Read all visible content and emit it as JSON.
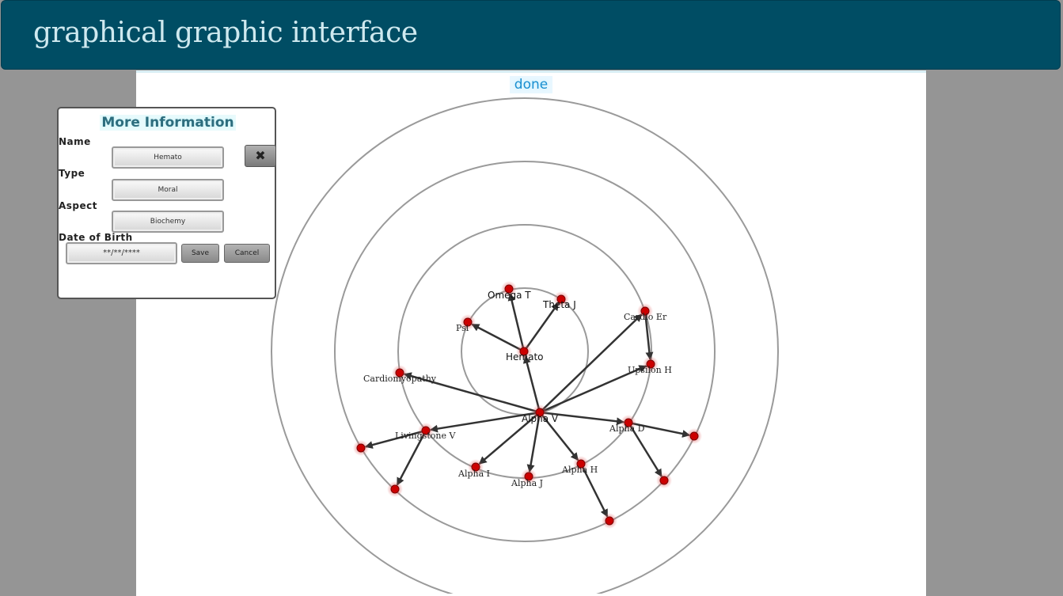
{
  "header": {
    "title": "graphical graphic interface"
  },
  "canvas": {
    "done_label": "done"
  },
  "info_panel": {
    "title": "More Information",
    "name_label": "Name",
    "name_value": "Hemato",
    "type_label": "Type",
    "type_value": "Moral",
    "aspect_label": "Aspect",
    "aspect_value": "Biochemy",
    "dob_label": "Date of Birth",
    "dob_value": "**/**/****",
    "save_label": "Save",
    "cancel_label": "Cancel",
    "close_icon": "close-x-icon"
  },
  "graph": {
    "colors": {
      "ring": "#9a9a9a",
      "edge": "#333333",
      "node": "#cc0000",
      "node_glow": "#e08a8a"
    },
    "nodes": [
      {
        "id": "hemato",
        "label": "Hemato"
      },
      {
        "id": "omegat",
        "label": "Omega T"
      },
      {
        "id": "thetaj",
        "label": "Theta J"
      },
      {
        "id": "psi",
        "label": "Psi"
      },
      {
        "id": "cardioer",
        "label": "Cardio Er"
      },
      {
        "id": "upsilonh",
        "label": "Upsilon H"
      },
      {
        "id": "cardiomyopathy",
        "label": "Cardiomyopathy"
      },
      {
        "id": "alphav",
        "label": "Alpha V"
      },
      {
        "id": "livingstonev",
        "label": "Livingstone V"
      },
      {
        "id": "alphad",
        "label": "Alpha D"
      },
      {
        "id": "alphai",
        "label": "Alpha I"
      },
      {
        "id": "alphaj",
        "label": "Alpha J"
      },
      {
        "id": "alphah",
        "label": "Alpha H"
      },
      {
        "id": "n1",
        "label": ""
      },
      {
        "id": "n2",
        "label": ""
      },
      {
        "id": "n3",
        "label": ""
      },
      {
        "id": "n4",
        "label": ""
      },
      {
        "id": "n5",
        "label": ""
      }
    ],
    "edges": [
      [
        "alphav",
        "hemato"
      ],
      [
        "hemato",
        "omegat"
      ],
      [
        "hemato",
        "thetaj"
      ],
      [
        "hemato",
        "psi"
      ],
      [
        "alphav",
        "cardioer"
      ],
      [
        "cardioer",
        "upsilonh"
      ],
      [
        "alphav",
        "upsilonh"
      ],
      [
        "alphav",
        "cardiomyopathy"
      ],
      [
        "alphav",
        "livingstonev"
      ],
      [
        "alphav",
        "alphad"
      ],
      [
        "alphav",
        "alphai"
      ],
      [
        "alphav",
        "alphaj"
      ],
      [
        "alphav",
        "alphah"
      ],
      [
        "livingstonev",
        "n1"
      ],
      [
        "livingstonev",
        "n2"
      ],
      [
        "alphad",
        "n3"
      ],
      [
        "alphad",
        "n4"
      ],
      [
        "alphah",
        "n5"
      ]
    ]
  }
}
